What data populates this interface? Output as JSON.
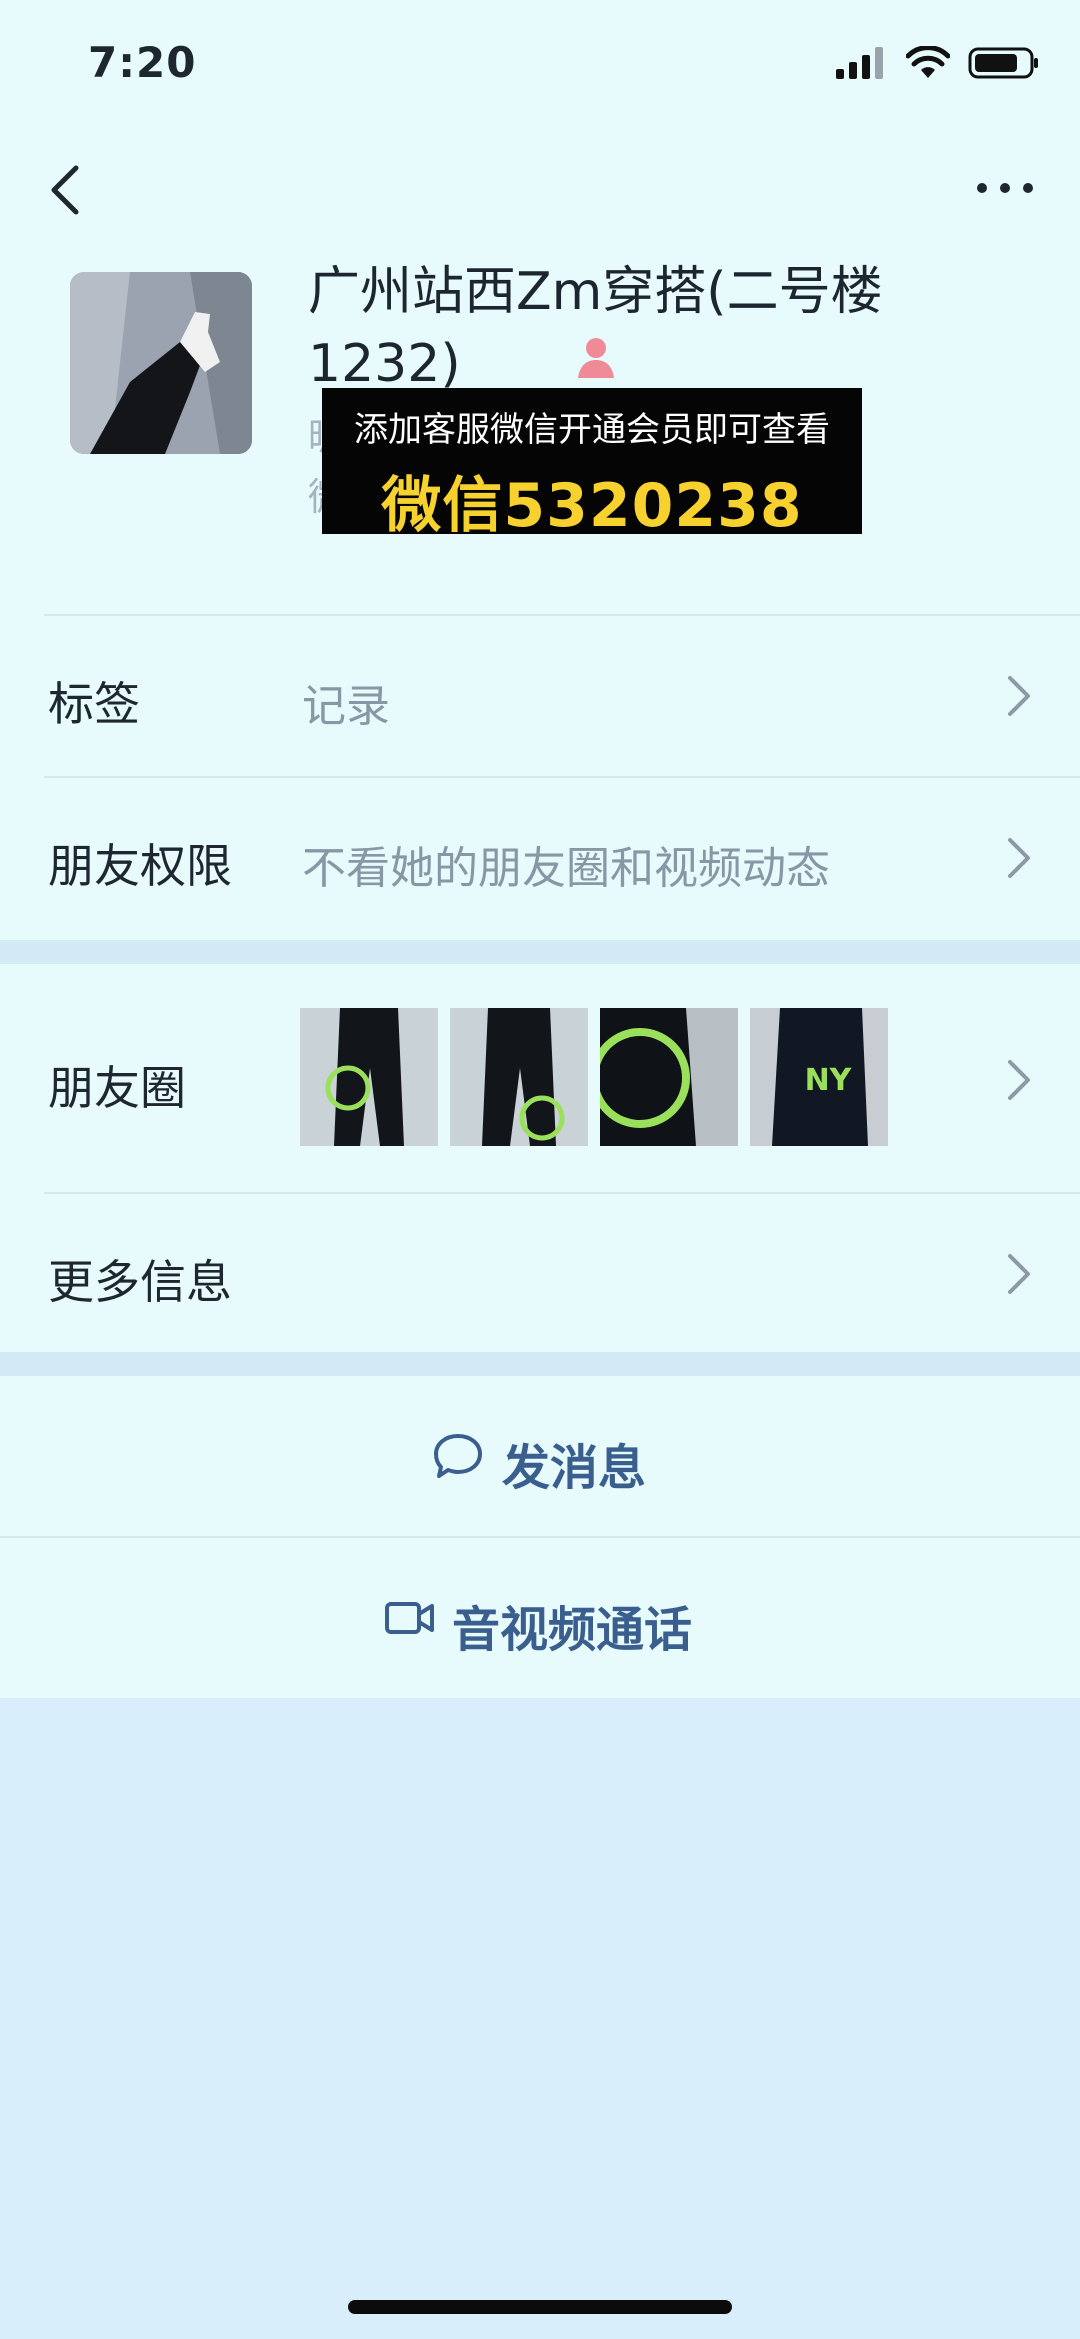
{
  "status_bar": {
    "time": "7:20"
  },
  "profile": {
    "name": "广州站西Zm穿搭(二号楼1232)",
    "peek_line1": "昵",
    "peek_line2": "微"
  },
  "promo": {
    "line1": "添加客服微信开通会员即可查看",
    "line2": "微信5320238"
  },
  "rows": {
    "tags": {
      "label": "标签",
      "value": "记录"
    },
    "permissions": {
      "label": "朋友权限",
      "value": "不看她的朋友圈和视频动态"
    },
    "moments": {
      "label": "朋友圈"
    },
    "more_info": {
      "label": "更多信息"
    }
  },
  "actions": {
    "message": "发消息",
    "call": "音视频通话"
  },
  "colors": {
    "accent": "#3a5f8f",
    "page_background": "#d8eefa",
    "card_background": "#e8fbfc",
    "promo_yellow": "#f7d12e"
  },
  "icons": {
    "back": "chevron-left-icon",
    "more": "more-dots-icon",
    "gender": "female-icon",
    "message": "chat-bubble-icon",
    "call": "video-camera-icon"
  }
}
